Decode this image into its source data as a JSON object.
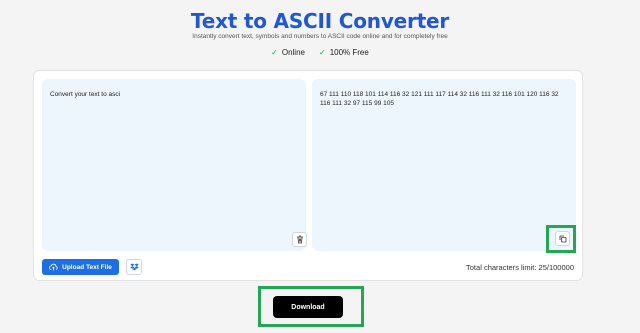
{
  "header": {
    "title": "Text to ASCII Converter",
    "subtitle": "Instantly convert text, symbols and numbers to ASCII code online and for completely free",
    "badges": [
      {
        "icon": "check-icon",
        "label": "Online"
      },
      {
        "icon": "check-icon",
        "label": "100% Free"
      }
    ]
  },
  "converter": {
    "input_text": "Convert your text to asci",
    "output_text": "67 111 110 118 101 114 116 32 121 111 117 114 32 116 111 32 116 101 120 116 32 116 111 32 97 115 99 105",
    "clear_icon": "trash-icon",
    "copy_icon": "copy-icon"
  },
  "toolbar": {
    "upload_label": "Upload Text File",
    "upload_icon": "cloud-upload-icon",
    "dropbox_icon": "dropbox-icon",
    "limit_text": "Total characters limit: 25/100000"
  },
  "actions": {
    "download_label": "Download"
  },
  "colors": {
    "title": "#1e58d6",
    "check": "#22a04b",
    "highlight": "#1fa951",
    "upload_button": "#1e6fe6",
    "panel_bg": "#eef6fd",
    "download_button": "#000000"
  }
}
